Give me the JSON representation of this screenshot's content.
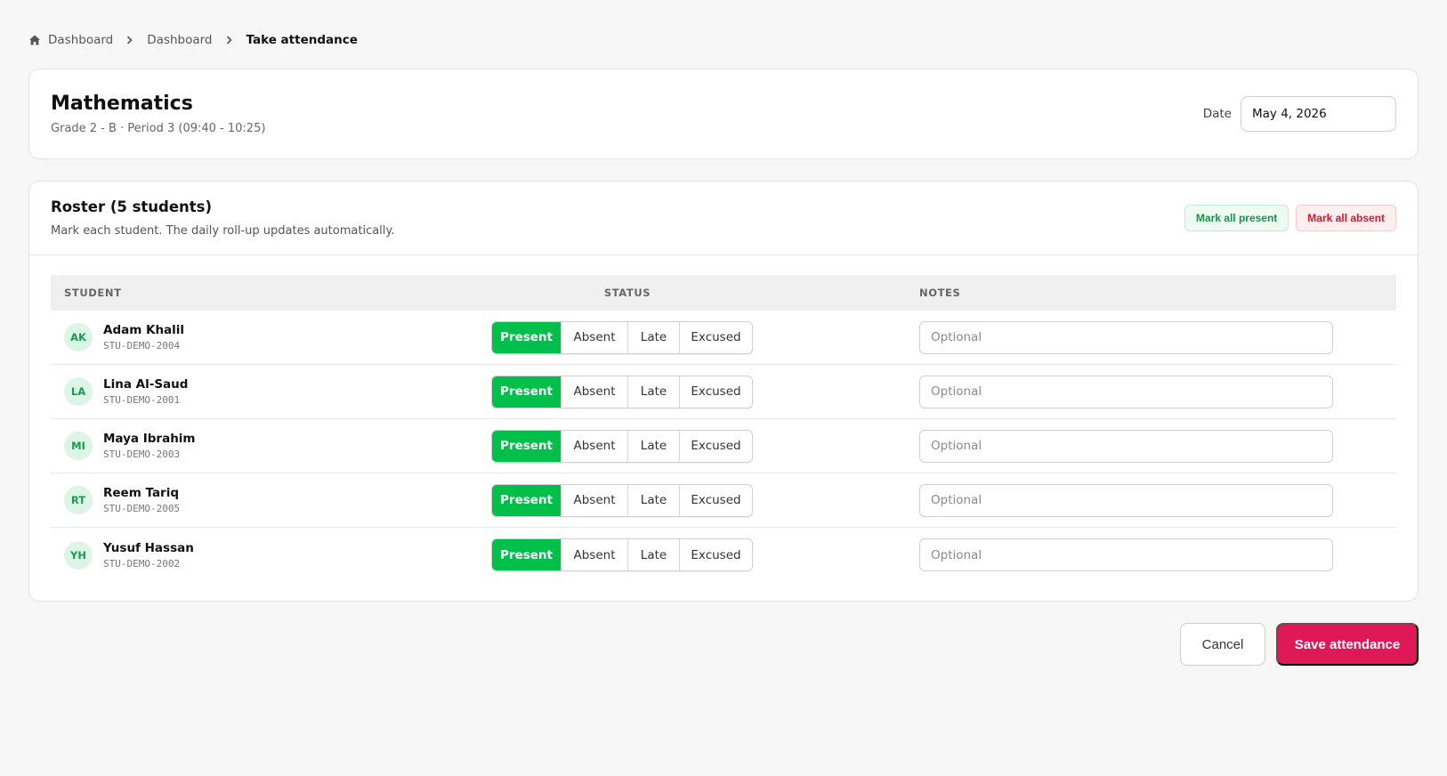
{
  "breadcrumb": {
    "items": [
      "Dashboard",
      "Dashboard"
    ],
    "current": "Take attendance"
  },
  "class": {
    "title": "Mathematics",
    "subtitle": "Grade 2 - B · Period 3 (09:40 - 10:25)",
    "date_label": "Date",
    "date_value": "May 4, 2026"
  },
  "roster": {
    "title": "Roster (5 students)",
    "subtitle": "Mark each student. The daily roll-up updates automatically.",
    "mark_all_present": "Mark all present",
    "mark_all_absent": "Mark all absent",
    "columns": {
      "student": "STUDENT",
      "status": "STATUS",
      "notes": "NOTES"
    },
    "status_options": [
      "Present",
      "Absent",
      "Late",
      "Excused"
    ],
    "notes_placeholder": "Optional",
    "students": [
      {
        "initials": "AK",
        "name": "Adam Khalil",
        "id": "STU-DEMO-2004",
        "status": "Present"
      },
      {
        "initials": "LA",
        "name": "Lina Al-Saud",
        "id": "STU-DEMO-2001",
        "status": "Present"
      },
      {
        "initials": "MI",
        "name": "Maya Ibrahim",
        "id": "STU-DEMO-2003",
        "status": "Present"
      },
      {
        "initials": "RT",
        "name": "Reem Tariq",
        "id": "STU-DEMO-2005",
        "status": "Present"
      },
      {
        "initials": "YH",
        "name": "Yusuf Hassan",
        "id": "STU-DEMO-2002",
        "status": "Present"
      }
    ]
  },
  "actions": {
    "cancel": "Cancel",
    "save": "Save attendance"
  },
  "colors": {
    "present_active": "#00c04b",
    "save": "#df1858",
    "absent_text": "#d21a2e"
  },
  "icons": {
    "home": "home-icon",
    "separator": "chevron-right-icon"
  }
}
